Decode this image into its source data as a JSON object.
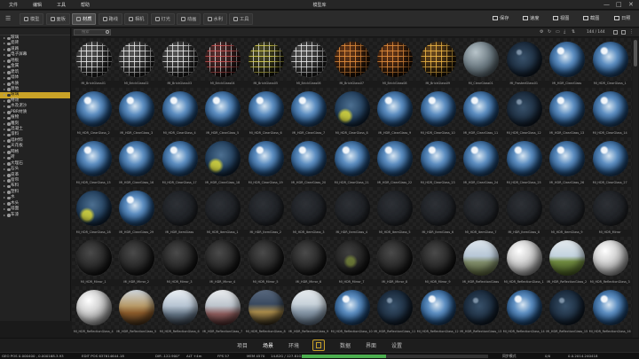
{
  "menubar": {
    "items": [
      "文件",
      "编辑",
      "工具",
      "帮助"
    ],
    "title": "模型库",
    "window_controls": [
      "—",
      "□",
      "✕"
    ]
  },
  "toolbar": {
    "tabs": [
      {
        "label": "模型",
        "icon": "cube-icon",
        "active": false
      },
      {
        "label": "面板",
        "icon": "panel-icon",
        "active": false
      },
      {
        "label": "材质",
        "icon": "material-icon",
        "active": true
      },
      {
        "label": "路线",
        "icon": "path-icon",
        "active": false
      },
      {
        "label": "相机",
        "icon": "camera-icon",
        "active": false
      },
      {
        "label": "灯光",
        "icon": "light-icon",
        "active": false
      },
      {
        "label": "动画",
        "icon": "animation-icon",
        "active": false
      },
      {
        "label": "水利",
        "icon": "water-icon",
        "active": false
      },
      {
        "label": "工具",
        "icon": "tool-icon",
        "active": false
      }
    ],
    "right": [
      {
        "label": "保存",
        "icon": "save-icon"
      },
      {
        "label": "速度",
        "icon": "speed-icon"
      },
      {
        "label": "视图",
        "icon": "view-icon"
      },
      {
        "label": "截图",
        "icon": "screenshot-icon"
      },
      {
        "label": "日照",
        "icon": "sun-icon"
      }
    ]
  },
  "tree": {
    "selected_index": 10,
    "items": [
      "玻璃",
      "瓷砖",
      "道路",
      "电子屏幕",
      "地板",
      "金属",
      "建筑",
      "墙体",
      "木质",
      "草地",
      "玻璃",
      "特效",
      "水及泥沙",
      "PBR材质",
      "植物",
      "雕刻",
      "混凝土",
      "漆料",
      "墙材料",
      "天花板",
      "网格",
      "砖",
      "大理石",
      "石头",
      "皮革",
      "窗帘",
      "布料",
      "塑料",
      "水",
      "木头",
      "墙面",
      "车漆"
    ]
  },
  "content_toolbar": {
    "search_placeholder": "搜索",
    "count": "144 / 144"
  },
  "items": [
    {
      "name": "MI_BrickGlass01",
      "style": "s-wire"
    },
    {
      "name": "MI_BrickGlass02",
      "style": "s-wire"
    },
    {
      "name": "MI_BrickGlass03",
      "style": "s-wire"
    },
    {
      "name": "MI_BrickGlass04",
      "style": "s-wire-red"
    },
    {
      "name": "MI_BrickGlass05",
      "style": "s-wire-yellow"
    },
    {
      "name": "MI_BrickGlass06",
      "style": "s-wire"
    },
    {
      "name": "MI_BrickGlass07",
      "style": "s-wire-copper"
    },
    {
      "name": "MI_BrickGlass08",
      "style": "s-wire-copper"
    },
    {
      "name": "MI_BrickGlass09",
      "style": "s-wire-gold"
    },
    {
      "name": "MI_ClearGlass01",
      "style": "s-frost"
    },
    {
      "name": "MI_FrostedGlass01",
      "style": "s-glass-dark"
    },
    {
      "name": "MI_HDR_ClearGlass",
      "style": "s-glass"
    },
    {
      "name": "MI_HDR_ClearGlass_1",
      "style": "s-glass"
    },
    {
      "name": "MI_HDR_ClearGlass_2",
      "style": "s-glass"
    },
    {
      "name": "MI_HDR_ClearGlass_3",
      "style": "s-glass"
    },
    {
      "name": "MI_HDR_ClearGlass_4",
      "style": "s-glass"
    },
    {
      "name": "MI_HDR_ClearGlass_5",
      "style": "s-glass"
    },
    {
      "name": "MI_HDR_ClearGlass_6",
      "style": "s-glass"
    },
    {
      "name": "MI_HDR_ClearGlass_7",
      "style": "s-glass"
    },
    {
      "name": "MI_HDR_ClearGlass_8",
      "style": "s-glass-green"
    },
    {
      "name": "MI_HDR_ClearGlass_9",
      "style": "s-glass"
    },
    {
      "name": "MI_HDR_ClearGlass_10",
      "style": "s-glass"
    },
    {
      "name": "MI_HDR_ClearGlass_11",
      "style": "s-glass"
    },
    {
      "name": "MI_HDR_ClearGlass_12",
      "style": "s-glass-dark"
    },
    {
      "name": "MI_HDR_ClearGlass_13",
      "style": "s-glass"
    },
    {
      "name": "MI_HDR_ClearGlass_14",
      "style": "s-glass"
    },
    {
      "name": "MI_HDR_ClearGlass_15",
      "style": "s-glass"
    },
    {
      "name": "MI_HDR_ClearGlass_16",
      "style": "s-glass"
    },
    {
      "name": "MI_HDR_ClearGlass_17",
      "style": "s-glass"
    },
    {
      "name": "MI_HDR_ClearGlass_18",
      "style": "s-glass-green"
    },
    {
      "name": "MI_HDR_ClearGlass_19",
      "style": "s-glass"
    },
    {
      "name": "MI_HDR_ClearGlass_20",
      "style": "s-glass"
    },
    {
      "name": "MI_HDR_ClearGlass_21",
      "style": "s-glass"
    },
    {
      "name": "MI_HDR_ClearGlass_22",
      "style": "s-glass"
    },
    {
      "name": "MI_HDR_ClearGlass_23",
      "style": "s-glass"
    },
    {
      "name": "MI_HDR_ClearGlass_24",
      "style": "s-glass"
    },
    {
      "name": "MI_HDR_ClearGlass_25",
      "style": "s-glass"
    },
    {
      "name": "MI_HDR_ClearGlass_26",
      "style": "s-glass"
    },
    {
      "name": "MI_HDR_ClearGlass_27",
      "style": "s-glass"
    },
    {
      "name": "MI_HDR_ClearGlass_28",
      "style": "s-glass-green"
    },
    {
      "name": "MI_HDR_ClearGlass_29",
      "style": "s-glass"
    },
    {
      "name": "MI_HDR_ItemGlass",
      "style": "s-faint"
    },
    {
      "name": "MI_HDR_ItemGlass_1",
      "style": "s-faint"
    },
    {
      "name": "MI_HDR_ItemGlass_2",
      "style": "s-faint"
    },
    {
      "name": "MI_HDR_ItemGlass_3",
      "style": "s-faint"
    },
    {
      "name": "MI_HDR_ItemGlass_4",
      "style": "s-faint"
    },
    {
      "name": "MI_HDR_ItemGlass_5",
      "style": "s-faint"
    },
    {
      "name": "MI_HDR_ItemGlass_6",
      "style": "s-faint"
    },
    {
      "name": "MI_HDR_ItemGlass_7",
      "style": "s-faint"
    },
    {
      "name": "MI_HDR_ItemGlass_8",
      "style": "s-faint"
    },
    {
      "name": "MI_HDR_ItemGlass_9",
      "style": "s-faint"
    },
    {
      "name": "MI_HDR_Mirror",
      "style": "s-faint"
    },
    {
      "name": "MI_HDR_Mirror_1",
      "style": "s-mirror"
    },
    {
      "name": "MI_HDR_Mirror_2",
      "style": "s-mirror"
    },
    {
      "name": "MI_HDR_Mirror_3",
      "style": "s-mirror"
    },
    {
      "name": "MI_HDR_Mirror_4",
      "style": "s-mirror"
    },
    {
      "name": "MI_HDR_Mirror_5",
      "style": "s-mirror"
    },
    {
      "name": "MI_HDR_Mirror_6",
      "style": "s-mirror"
    },
    {
      "name": "MI_HDR_Mirror_7",
      "style": "s-mirror-g"
    },
    {
      "name": "MI_HDR_Mirror_8",
      "style": "s-mirror"
    },
    {
      "name": "MI_HDR_Mirror_9",
      "style": "s-mirror"
    },
    {
      "name": "MI_HDR_ReflectionGlass",
      "style": "s-sky"
    },
    {
      "name": "MI_HDR_ReflectionGlass_1",
      "style": "s-chrome"
    },
    {
      "name": "MI_HDR_ReflectionGlass_2",
      "style": "s-sky-green"
    },
    {
      "name": "MI_HDR_ReflectionGlass_3",
      "style": "s-chrome"
    },
    {
      "name": "MI_HDR_ReflectionGlass_4",
      "style": "s-chrome"
    },
    {
      "name": "MI_HDR_ReflectionGlass_5",
      "style": "s-sunset"
    },
    {
      "name": "MI_HDR_ReflectionGlass_6",
      "style": "s-chrome-blue"
    },
    {
      "name": "MI_HDR_ReflectionGlass_7",
      "style": "s-chrome-red"
    },
    {
      "name": "MI_HDR_ReflectionGlass_8",
      "style": "s-city"
    },
    {
      "name": "MI_HDR_ReflectionGlass_9",
      "style": "s-wave"
    },
    {
      "name": "MI_HDR_ReflectionGlass_10",
      "style": "s-glass"
    },
    {
      "name": "MI_HDR_ReflectionGlass_11",
      "style": "s-glass-dark"
    },
    {
      "name": "MI_HDR_ReflectionGlass_12",
      "style": "s-glass"
    },
    {
      "name": "MI_HDR_ReflectionGlass_13",
      "style": "s-glass-dark"
    },
    {
      "name": "MI_HDR_ReflectionGlass_14",
      "style": "s-glass"
    },
    {
      "name": "MI_HDR_ReflectionGlass_15",
      "style": "s-glass-dark"
    },
    {
      "name": "MI_HDR_ReflectionGlass_16",
      "style": "s-glass"
    }
  ],
  "bottom_tabs": {
    "left": [
      "项目",
      "场景",
      "环境"
    ],
    "right": [
      "数据",
      "界面",
      "设置"
    ],
    "active": "场景"
  },
  "status": {
    "geo": "GEO POS  0.000400 , 0.000168.3.93",
    "edit": "EDIT POS  637614644.18",
    "dir": "DIR  -122.900°",
    "alt": "ALT  +4m",
    "fps": "FPS  57",
    "mem": "MEM  4570",
    "tris": "14.82G / 127.81G",
    "mode": "同步模式",
    "flags": "0/0",
    "time": "0.0.2014.240418",
    "progress": 0.45
  },
  "colors": {
    "accent": "#c9a227",
    "background": "#1a1a1a",
    "panel": "#222222"
  }
}
